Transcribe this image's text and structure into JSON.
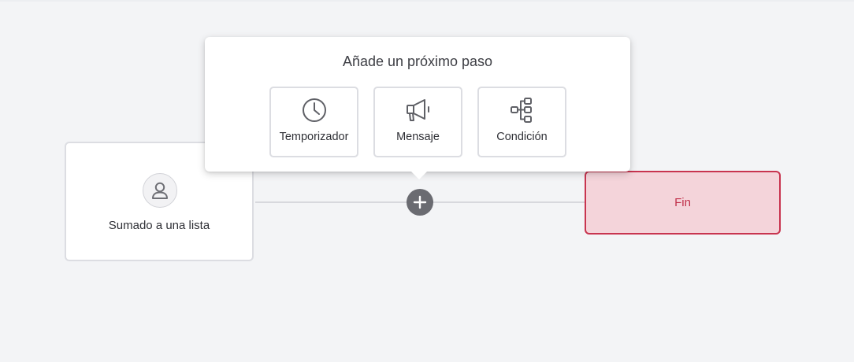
{
  "popover": {
    "title": "Añade un próximo paso",
    "options": [
      {
        "label": "Temporizador",
        "icon": "clock-icon"
      },
      {
        "label": "Mensaje",
        "icon": "megaphone-icon"
      },
      {
        "label": "Condición",
        "icon": "branch-icon"
      }
    ]
  },
  "flow": {
    "start_node": {
      "label": "Sumado a una lista",
      "icon": "user-icon"
    },
    "end_node": {
      "label": "Fin"
    },
    "add_button_icon": "plus-icon"
  },
  "colors": {
    "background": "#f3f4f6",
    "end_fill": "#f4d4da",
    "end_border": "#c8344f",
    "end_text": "#c0304a",
    "add_button": "#6a6b71"
  }
}
